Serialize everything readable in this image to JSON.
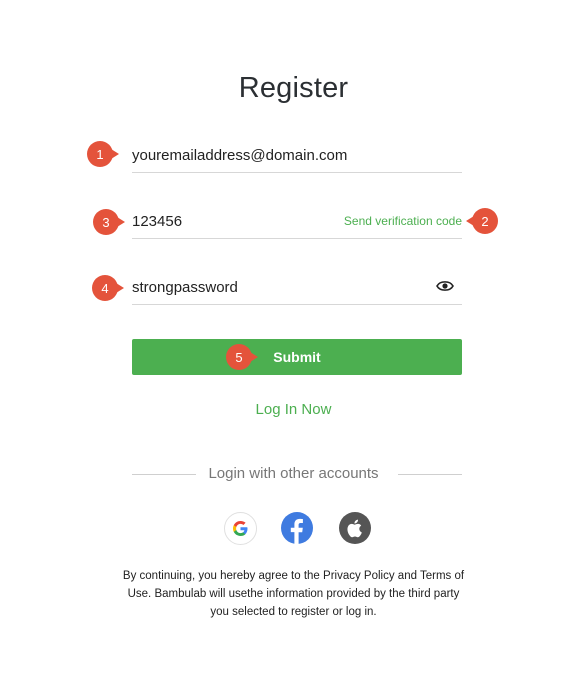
{
  "page": {
    "title": "Register"
  },
  "form": {
    "email_value": "youremailaddress@domain.com",
    "code_value": "123456",
    "send_code_label": "Send verification code",
    "password_value": "strongpassword",
    "submit_label": "Submit"
  },
  "login_now_label": "Log In Now",
  "other_accounts_label": "Login with other accounts",
  "social": [
    "google-icon",
    "facebook-icon",
    "apple-icon"
  ],
  "terms_text": "By continuing, you hereby agree to the Privacy Policy and Terms of Use. Bambulab will usethe information provided by the third party you selected to register or log in.",
  "annotations": [
    "1",
    "2",
    "3",
    "4",
    "5"
  ],
  "colors": {
    "accent": "#4caf50",
    "badge": "#e4533b",
    "facebook": "#3f7be0",
    "apple": "#555555"
  }
}
